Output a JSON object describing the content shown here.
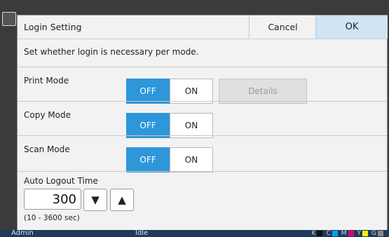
{
  "dialog": {
    "title": "Login Setting",
    "cancel_label": "Cancel",
    "ok_label": "OK",
    "description": "Set whether login is necessary per mode."
  },
  "modes": [
    {
      "label": "Print Mode",
      "off_label": "OFF",
      "on_label": "ON",
      "selected": "OFF",
      "details_label": "Details"
    },
    {
      "label": "Copy Mode",
      "off_label": "OFF",
      "on_label": "ON",
      "selected": "OFF"
    },
    {
      "label": "Scan Mode",
      "off_label": "OFF",
      "on_label": "ON",
      "selected": "OFF"
    }
  ],
  "auto_logout": {
    "label": "Auto Logout Time",
    "value": "300",
    "decrease_icon": "triangle-down",
    "increase_icon": "triangle-up",
    "range_text": "(10 - 3600 sec)"
  },
  "statusbar": {
    "user": "Admin",
    "state": "Idle",
    "inks": [
      "K",
      "C",
      "M",
      "Y",
      "G"
    ],
    "ink_colors": [
      "#111111",
      "#00a0e9",
      "#e4007f",
      "#fff100",
      "#8a8a8a"
    ]
  },
  "colors": {
    "selected_toggle": "#2d97da",
    "ok_button": "#cfe4f4",
    "statusbar": "#1f3a5a"
  }
}
